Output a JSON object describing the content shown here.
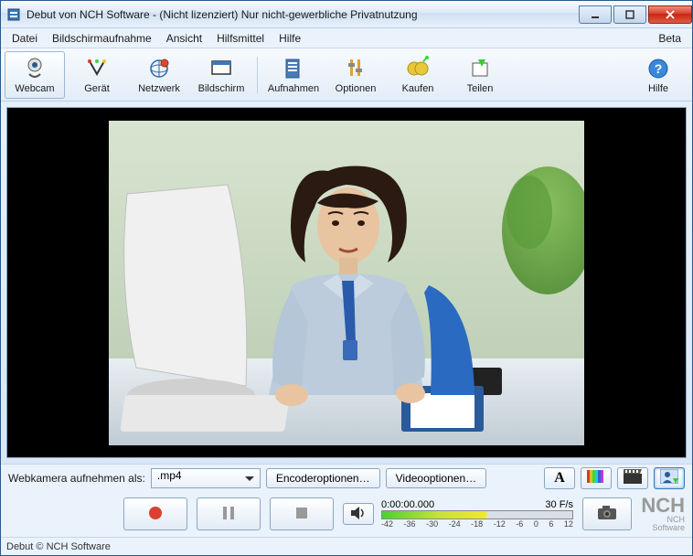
{
  "window": {
    "title": "Debut von NCH Software - (Nicht lizenziert) Nur nicht-gewerbliche Privatnutzung"
  },
  "menu": {
    "datei": "Datei",
    "bildschirmaufnahme": "Bildschirmaufnahme",
    "ansicht": "Ansicht",
    "hilfsmittel": "Hilfsmittel",
    "hilfe": "Hilfe",
    "beta": "Beta"
  },
  "toolbar": {
    "webcam": "Webcam",
    "geraet": "Gerät",
    "netzwerk": "Netzwerk",
    "bildschirm": "Bildschirm",
    "aufnahmen": "Aufnahmen",
    "optionen": "Optionen",
    "kaufen": "Kaufen",
    "teilen": "Teilen",
    "hilfe": "Hilfe"
  },
  "options": {
    "record_as_label": "Webkamera aufnehmen als:",
    "format_selected": ".mp4",
    "encoder_btn": "Encoderoptionen…",
    "video_btn": "Videooptionen…"
  },
  "meter": {
    "timestamp": "0:00:00.000",
    "fps": "30 F/s",
    "ticks": [
      "-42",
      "-36",
      "-30",
      "-24",
      "-18",
      "-12",
      "-6",
      "0",
      "6",
      "12"
    ]
  },
  "logo": {
    "big": "NCH",
    "small": "NCH Software"
  },
  "status": {
    "text": "Debut © NCH Software"
  }
}
